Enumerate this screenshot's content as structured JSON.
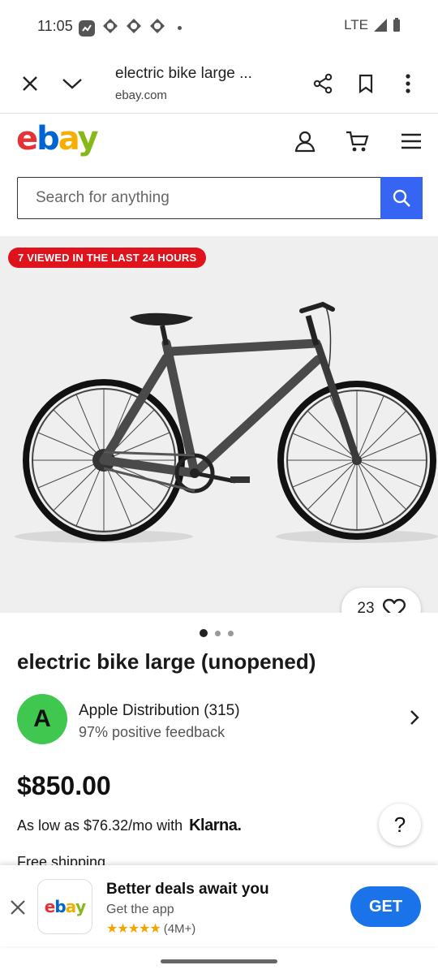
{
  "status_bar": {
    "time": "11:05",
    "network": "LTE"
  },
  "browser": {
    "page_title": "electric bike large ...",
    "domain": "ebay.com",
    "icons": [
      "close-icon",
      "chevron-down-icon",
      "share-icon",
      "bookmark-icon",
      "more-vertical-icon"
    ]
  },
  "header": {
    "logo": [
      "e",
      "b",
      "a",
      "y"
    ],
    "search_placeholder": "Search for anything",
    "icons": [
      "account-icon",
      "cart-icon",
      "menu-icon",
      "search-icon"
    ]
  },
  "product": {
    "viewed_badge": "7 VIEWED IN THE LAST 24 HOURS",
    "watch_count": "23",
    "image_count": 3,
    "active_image": 1,
    "title": "electric bike large (unopened)",
    "price": "$850.00",
    "financing_text": "As low as $76.32/mo with",
    "financing_provider": "Klarna.",
    "shipping": "Free shipping"
  },
  "seller": {
    "initial": "A",
    "name": "Apple Distribution (315)",
    "feedback": "97% positive feedback",
    "avatar_color": "#3fc74f"
  },
  "app_banner": {
    "logo": [
      "e",
      "b",
      "a",
      "y"
    ],
    "title": "Better deals await you",
    "subtitle": "Get the app",
    "stars": "★★★★★",
    "rating_count": "(4M+)",
    "cta": "GET"
  },
  "colors": {
    "accent": "#3665f3",
    "badge_red": "#e0121b",
    "get_button": "#1a73e8"
  }
}
